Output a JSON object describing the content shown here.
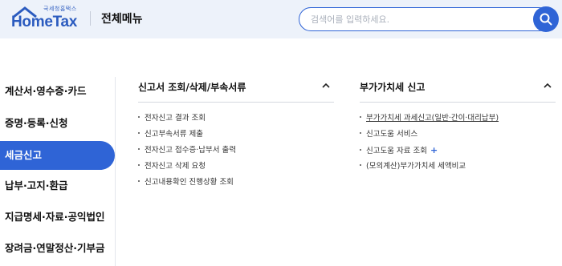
{
  "header": {
    "logo_small": "국세청홈택스",
    "logo_main": "HomeTax",
    "menu_title": "전체메뉴",
    "search_placeholder": "검색어를 입력하세요."
  },
  "left_nav": [
    {
      "label": "계산서·영수증·카드",
      "active": false
    },
    {
      "label": "증명·등록·신청",
      "active": false
    },
    {
      "label": "세금신고",
      "active": true
    },
    {
      "label": "납부·고지·환급",
      "active": false
    },
    {
      "label": "지급명세·자료·공익법인",
      "active": false
    },
    {
      "label": "장려금·연말정산·기부금",
      "active": false
    }
  ],
  "sections": [
    {
      "title": "신고서 조회/삭제/부속서류",
      "items": [
        "전자신고 결과 조회",
        "신고부속서류 제출",
        "전자신고 접수증·납부서 출력",
        "전자신고 삭제 요청",
        "신고내용확인 진행상황 조회"
      ]
    },
    {
      "title": "부가가치세 신고",
      "items": [
        "부가가치세 과세신고(일반·간이·대리납부)",
        "신고도움 서비스",
        "신고도움 자료 조회",
        "(모의계산)부가가치세 세액비교"
      ],
      "plus_symbol": "+"
    }
  ],
  "colors": {
    "accent": "#2f64d6",
    "header_bg": "#edf2fa"
  }
}
